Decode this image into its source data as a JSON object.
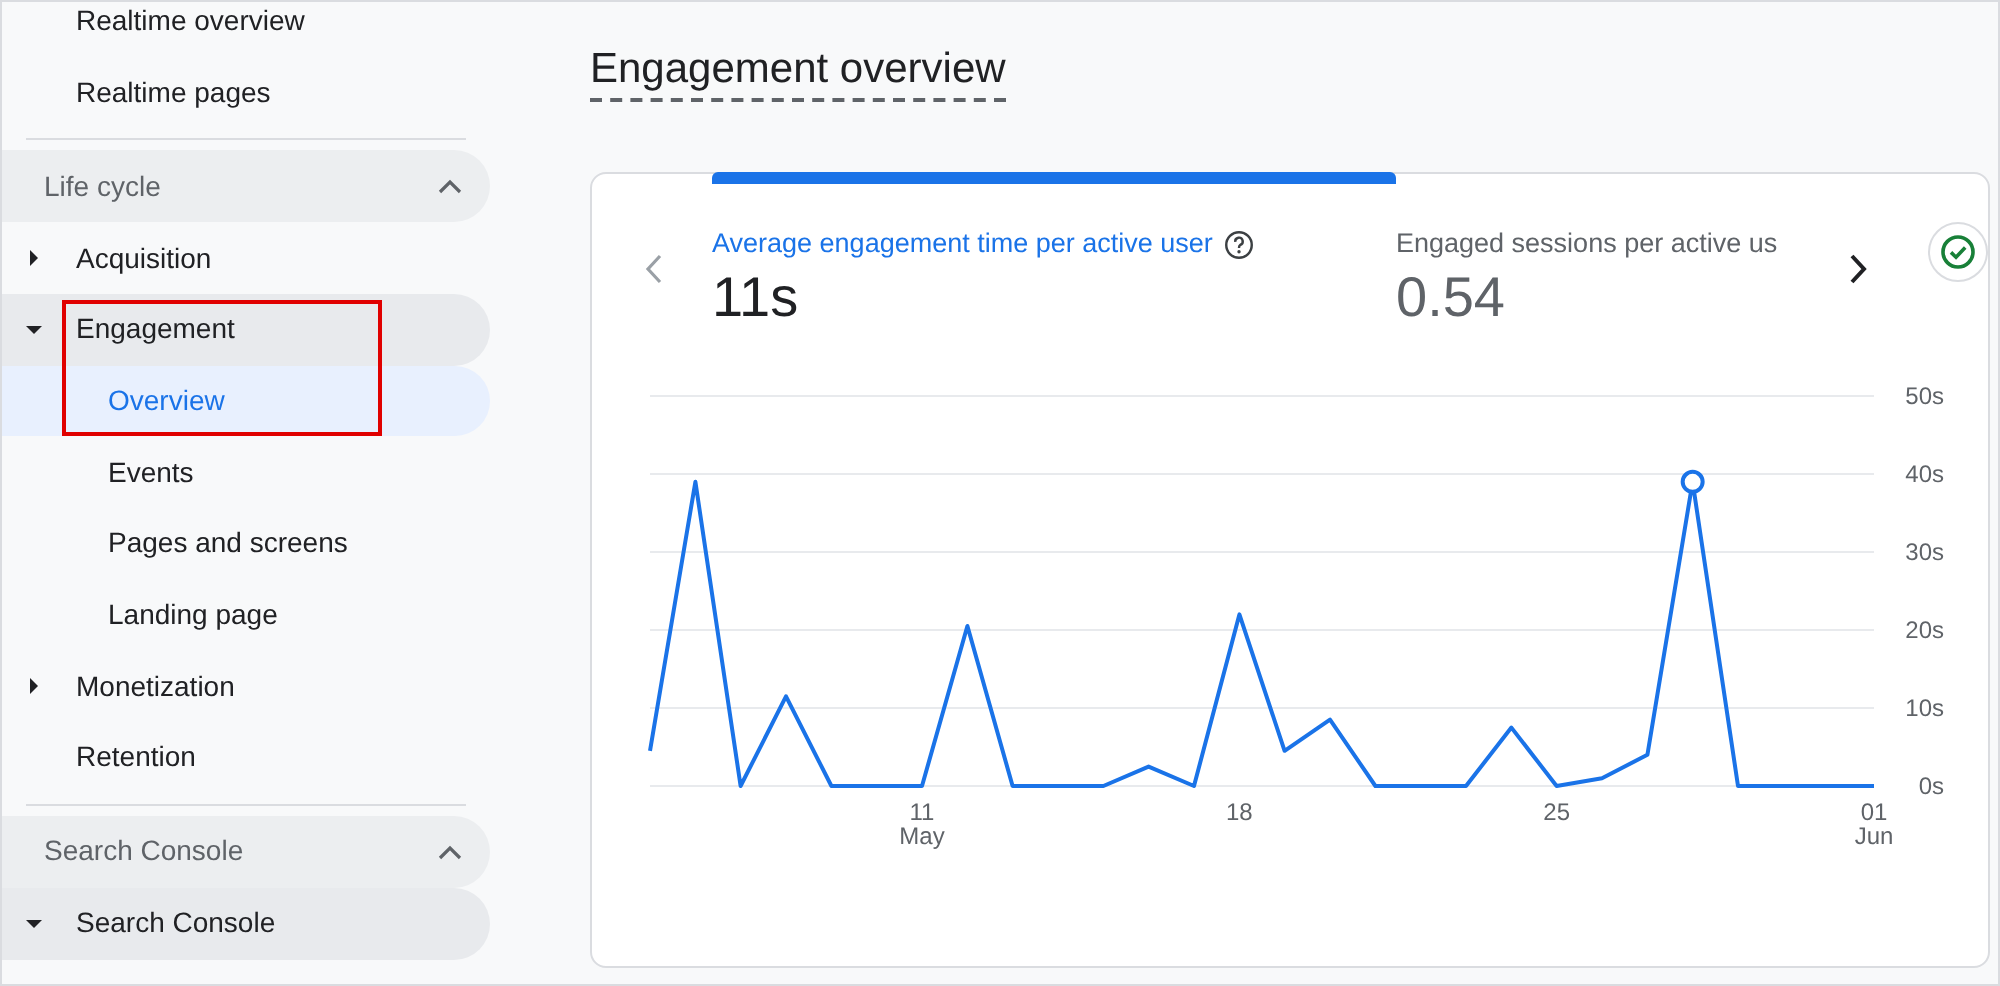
{
  "sidebar": {
    "items": [
      {
        "kind": "item",
        "label": "Realtime overview"
      },
      {
        "kind": "item",
        "label": "Realtime pages"
      },
      {
        "kind": "divider"
      },
      {
        "kind": "section",
        "label": "Life cycle",
        "expanded": true,
        "children": [
          {
            "kind": "group",
            "label": "Acquisition",
            "expanded": false,
            "selected": false,
            "outlined": false
          },
          {
            "kind": "group",
            "label": "Engagement",
            "expanded": true,
            "selected": false,
            "outlined": true,
            "children": [
              {
                "kind": "child",
                "label": "Overview",
                "selected": true,
                "outlined": true
              },
              {
                "kind": "child",
                "label": "Events",
                "selected": false,
                "outlined": false
              },
              {
                "kind": "child",
                "label": "Pages and screens",
                "selected": false,
                "outlined": false
              },
              {
                "kind": "child",
                "label": "Landing page",
                "selected": false,
                "outlined": false
              }
            ]
          },
          {
            "kind": "group",
            "label": "Monetization",
            "expanded": false,
            "selected": false,
            "outlined": false
          },
          {
            "kind": "item",
            "label": "Retention"
          }
        ]
      },
      {
        "kind": "divider"
      },
      {
        "kind": "section",
        "label": "Search Console",
        "expanded": true,
        "children": [
          {
            "kind": "group",
            "label": "Search Console",
            "expanded": true,
            "selected": false,
            "outlined": false
          }
        ]
      }
    ]
  },
  "page_title": "Engagement overview",
  "card": {
    "metrics": [
      {
        "label": "Average engagement time per active user",
        "value": "11s",
        "selected": true
      },
      {
        "label": "Engaged sessions per active us",
        "value": "0.54",
        "selected": false
      }
    ],
    "status_ok": true,
    "peak_marker": true,
    "chart_data": {
      "type": "line",
      "categories": [
        null,
        null,
        null,
        null,
        null,
        null,
        "11\nMay",
        null,
        null,
        null,
        null,
        null,
        null,
        "18",
        null,
        null,
        null,
        null,
        null,
        null,
        "25",
        null,
        null,
        null,
        null,
        null,
        null,
        "01\nJun"
      ],
      "grid": true,
      "series": [
        {
          "color": "#1a73e8",
          "values": [
            4.5,
            39,
            0,
            11.5,
            0,
            0,
            0,
            20.5,
            0,
            0,
            0,
            2.5,
            0,
            22,
            4.5,
            8.5,
            0,
            0,
            0,
            7.5,
            0,
            1,
            4,
            39,
            0,
            0,
            0,
            0
          ]
        }
      ],
      "ylim": [
        0,
        50
      ],
      "yticks": [
        {
          "value": 0,
          "label": "0s"
        },
        {
          "value": 10,
          "label": "10s"
        },
        {
          "value": 20,
          "label": "20s"
        },
        {
          "value": 30,
          "label": "30s"
        },
        {
          "value": 40,
          "label": "40s"
        },
        {
          "value": 50,
          "label": "50s"
        }
      ]
    }
  }
}
